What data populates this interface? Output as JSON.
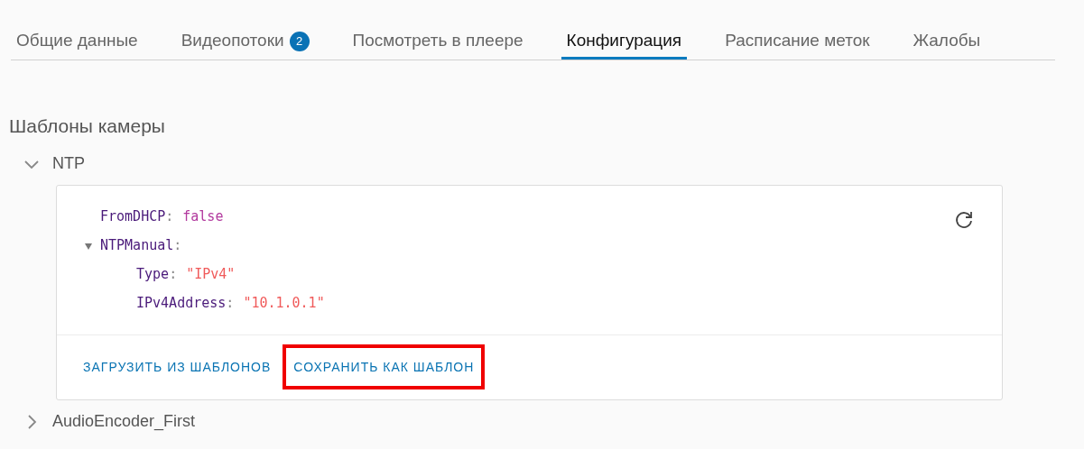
{
  "tabs": [
    {
      "label": "Общие данные",
      "selected": false
    },
    {
      "label": "Видеопотоки",
      "selected": false,
      "badge": "2"
    },
    {
      "label": "Посмотреть в плеере",
      "selected": false
    },
    {
      "label": "Конфигурация",
      "selected": true
    },
    {
      "label": "Расписание меток",
      "selected": false
    },
    {
      "label": "Жалобы",
      "selected": false
    }
  ],
  "section_title": "Шаблоны камеры",
  "templates": [
    {
      "name": "NTP",
      "expanded": true,
      "tree": [
        {
          "key": "FromDHCP",
          "separator": ":",
          "value": "false",
          "kind": "boolean"
        },
        {
          "key": "NTPManual",
          "separator": ":",
          "kind": "object",
          "expanded": true,
          "children": [
            {
              "key": "Type",
              "separator": ":",
              "value": "\"IPv4\"",
              "kind": "string"
            },
            {
              "key": "IPv4Address",
              "separator": ":",
              "value": "\"10.1.0.1\"",
              "kind": "string"
            }
          ]
        }
      ],
      "actions": [
        {
          "label": "ЗАГРУЗИТЬ ИЗ ШАБЛОНОВ",
          "highlighted": false
        },
        {
          "label": "СОХРАНИТЬ КАК ШАБЛОН",
          "highlighted": true
        }
      ]
    },
    {
      "name": "AudioEncoder_First",
      "expanded": false
    }
  ]
}
